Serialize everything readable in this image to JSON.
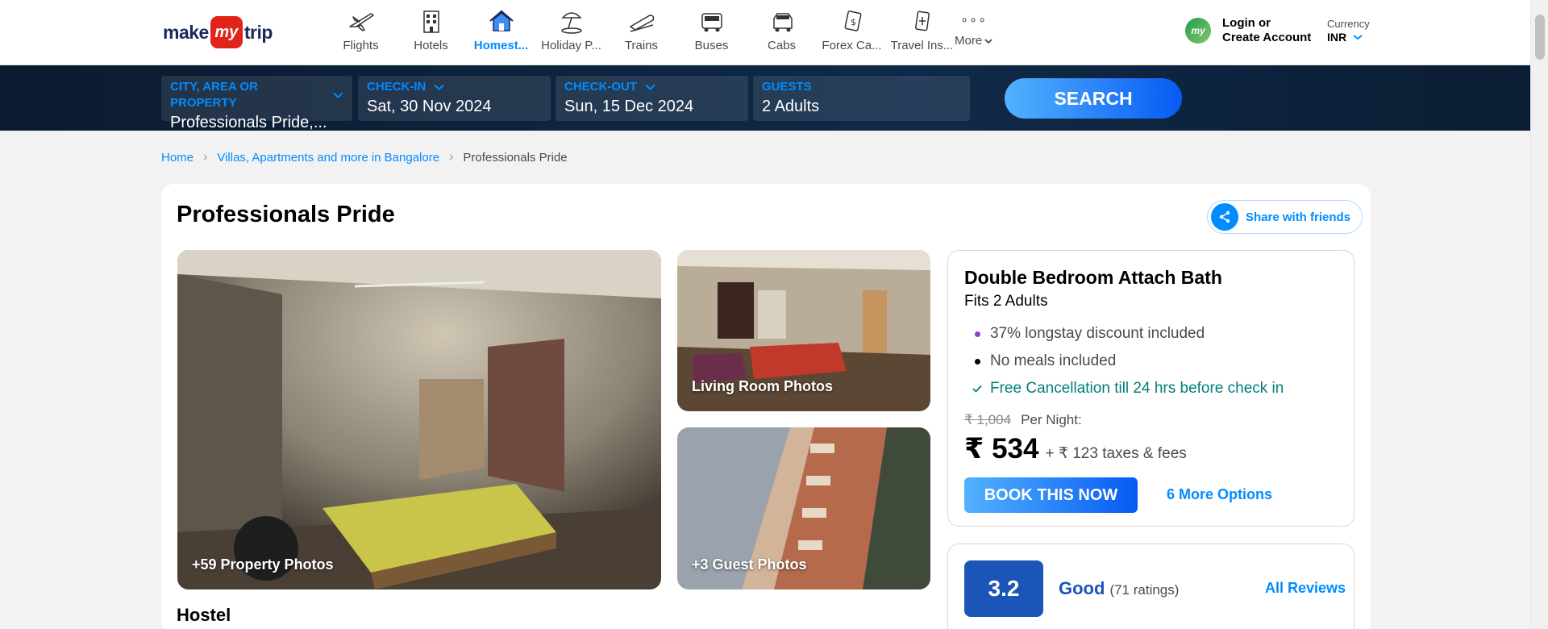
{
  "brand": {
    "part1": "make",
    "part2": "my",
    "part3": "trip"
  },
  "nav": {
    "items": [
      {
        "label": "Flights",
        "icon": "flight-icon",
        "active": false
      },
      {
        "label": "Hotels",
        "icon": "hotel-icon",
        "active": false
      },
      {
        "label": "Homest...",
        "icon": "homestay-icon",
        "active": true
      },
      {
        "label": "Holiday P...",
        "icon": "holiday-package-icon",
        "active": false
      },
      {
        "label": "Trains",
        "icon": "train-icon",
        "active": false
      },
      {
        "label": "Buses",
        "icon": "bus-icon",
        "active": false
      },
      {
        "label": "Cabs",
        "icon": "cab-icon",
        "active": false
      },
      {
        "label": "Forex Ca...",
        "icon": "forex-card-icon",
        "active": false
      },
      {
        "label": "Travel Ins...",
        "icon": "travel-insurance-icon",
        "active": false
      }
    ],
    "more_label": "More",
    "active_color": "#008cff"
  },
  "account": {
    "login_line1": "Login or",
    "login_line2": "Create Account"
  },
  "currency": {
    "label": "Currency",
    "value": "INR"
  },
  "search": {
    "city_label": "CITY, AREA OR PROPERTY",
    "city_value": "Professionals Pride,...",
    "checkin_label": "CHECK-IN",
    "checkin_value": "Sat, 30 Nov 2024",
    "checkout_label": "CHECK-OUT",
    "checkout_value": "Sun, 15 Dec 2024",
    "guests_label": "GUESTS",
    "guests_value": "2 Adults",
    "button_label": "SEARCH"
  },
  "breadcrumb": {
    "home": "Home",
    "category": "Villas, Apartments and more in Bangalore",
    "current": "Professionals Pride"
  },
  "property": {
    "title": "Professionals Pride",
    "share_label": "Share with friends",
    "type": "Hostel",
    "photos": {
      "main_caption": "+59 Property Photos",
      "living_caption": "Living Room Photos",
      "guest_caption": "+3 Guest Photos"
    }
  },
  "room": {
    "name": "Double Bedroom Attach Bath",
    "fits": "Fits 2 Adults",
    "features": [
      {
        "text": "37% longstay discount included",
        "style": "purple-dot"
      },
      {
        "text": "No meals included",
        "style": "black-dot"
      },
      {
        "text": "Free Cancellation till 24 hrs before check in",
        "style": "green-check"
      }
    ],
    "old_price": "₹ 1,004",
    "per_night": "Per Night:",
    "price": "₹ 534",
    "taxes": "+ ₹ 123 taxes & fees",
    "book_label": "BOOK THIS NOW",
    "more_options": "6 More Options"
  },
  "rating": {
    "score": "3.2",
    "label": "Good",
    "count": "(71 ratings)",
    "all_reviews": "All Reviews",
    "color": "#1b55b7"
  }
}
